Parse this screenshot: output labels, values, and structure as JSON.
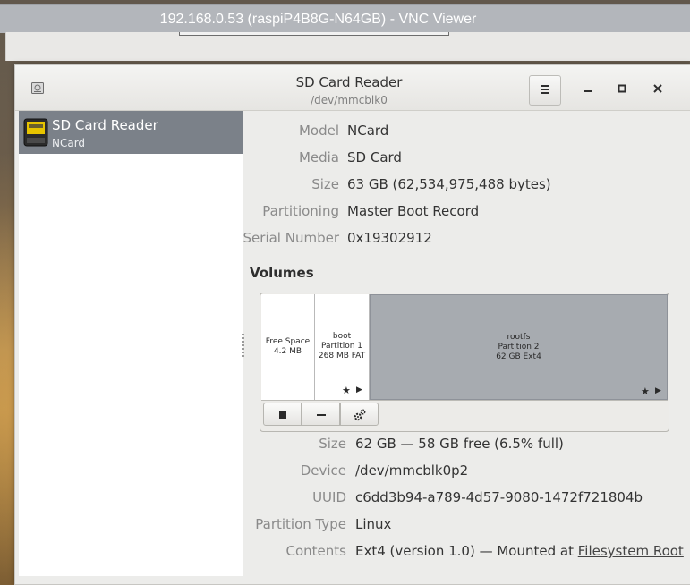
{
  "vnc": {
    "title": "192.168.0.53 (raspiP4B8G-N64GB) - VNC Viewer"
  },
  "window": {
    "title": "SD Card Reader",
    "subtitle": "/dev/mmcblk0",
    "menu_icon": "hamburger-menu-icon",
    "minimize_icon": "minimize-icon",
    "maximize_icon": "maximize-icon",
    "close_icon": "close-icon"
  },
  "sidebar": {
    "items": [
      {
        "label": "SD Card Reader",
        "sublabel": "NCard",
        "icon": "sd-card-icon",
        "selected": true
      }
    ]
  },
  "drive": {
    "model_label": "Model",
    "model": "NCard",
    "media_label": "Media",
    "media": "SD Card",
    "size_label": "Size",
    "size": "63 GB (62,534,975,488 bytes)",
    "partitioning_label": "Partitioning",
    "partitioning": "Master Boot Record",
    "serial_label": "Serial Number",
    "serial": "0x19302912"
  },
  "volumes": {
    "heading": "Volumes",
    "segments": [
      {
        "name": "Free Space",
        "line2": "4.2 MB",
        "line3": ""
      },
      {
        "name": "boot",
        "line2": "Partition 1",
        "line3": "268 MB FAT",
        "star_icon": "star-icon",
        "play_icon": "play-icon"
      },
      {
        "name": "rootfs",
        "line2": "Partition 2",
        "line3": "62 GB Ext4",
        "star_icon": "star-icon",
        "play_icon": "play-icon",
        "selected": true
      }
    ],
    "tools": [
      "stop-icon",
      "minus-icon",
      "gears-icon"
    ]
  },
  "partition": {
    "size_label": "Size",
    "size": "62 GB — 58 GB free (6.5% full)",
    "device_label": "Device",
    "device": "/dev/mmcblk0p2",
    "uuid_label": "UUID",
    "uuid": "c6dd3b94-a789-4d57-9080-1472f721804b",
    "type_label": "Partition Type",
    "type": "Linux",
    "contents_label": "Contents",
    "contents_prefix": "Ext4 (version 1.0) — Mounted at ",
    "contents_link": "Filesystem Root"
  },
  "colors": {
    "selected_row": "#7b8189",
    "selected_segment": "#a7abb0",
    "window_bg": "#ececea"
  }
}
